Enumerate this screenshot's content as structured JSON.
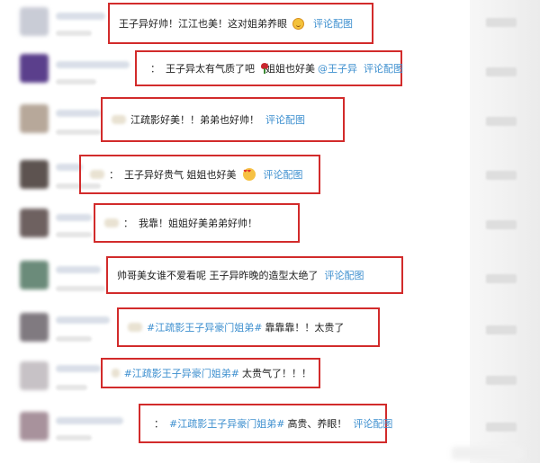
{
  "comments": [
    {
      "text": "王子异好帅！江江也美！这对姐弟养眼",
      "link": "评论配图"
    },
    {
      "text": "王子异太有气质了吧",
      "text2": "姐姐也好美",
      "mention": "@王子异",
      "link": "评论配图"
    },
    {
      "text": "江疏影好美！！弟弟也好帅！",
      "link": "评论配图"
    },
    {
      "text": "王子异好贵气 姐姐也好美",
      "link": "评论配图"
    },
    {
      "text": "我靠！姐姐好美弟弟好帅！"
    },
    {
      "text": "帅哥美女谁不爱看呢 王子异昨晚的造型太绝了",
      "link": "评论配图"
    },
    {
      "hashtag": "#江疏影王子异豪门姐弟#",
      "text": "靠靠靠！！太贵了"
    },
    {
      "hashtag": "#江疏影王子异豪门姐弟#",
      "text": "太贵气了！！！"
    },
    {
      "hashtag": "#江疏影王子异豪门姐弟#",
      "text": "高贵、养眼！",
      "link": "评论配图"
    }
  ],
  "colon": "：",
  "icons": {
    "emoji1": "red-envelope-face-icon",
    "rose": "rose-icon",
    "emoji2": "heart-eyes-icon"
  },
  "colors": {
    "highlight_box": "#d22b2b",
    "link": "#3d8fcf"
  }
}
